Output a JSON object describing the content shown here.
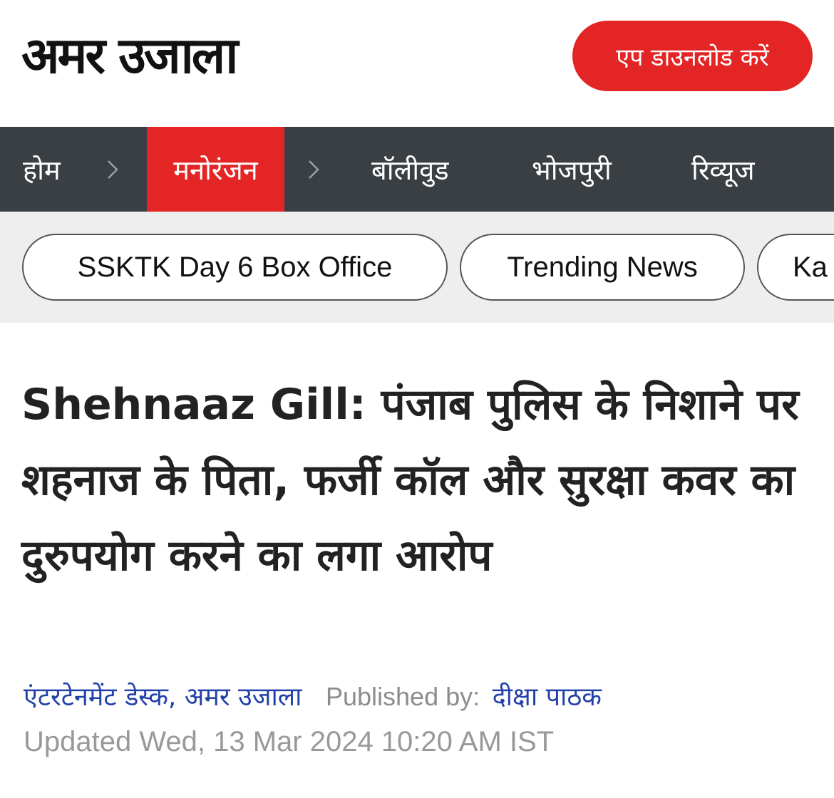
{
  "header": {
    "logo_text": "अमर उजाला",
    "app_download_label": "एप डाउनलोड करें"
  },
  "nav": {
    "items": [
      {
        "label": "होम"
      },
      {
        "label": "मनोरंजन",
        "active": true
      },
      {
        "label": "बॉलीवुड"
      },
      {
        "label": "भोजपुरी"
      },
      {
        "label": "रिव्यूज"
      }
    ],
    "separator_icon": "chevron-right-icon"
  },
  "chips": [
    {
      "label": "SSKTK Day 6 Box Office"
    },
    {
      "label": "Trending News"
    },
    {
      "label": "Ka"
    }
  ],
  "article": {
    "headline": "Shehnaaz Gill: पंजाब पुलिस के निशाने पर शहनाज के पिता, फर्जी कॉल और सुरक्षा कवर का दुरुपयोग करने का लगा आरोप",
    "desk": "एंटरटेनमेंट डेस्क, अमर उजाला",
    "published_by_label": "Published by:",
    "author": "दीक्षा पाठक",
    "updated": "Updated Wed, 13 Mar 2024 10:20 AM IST"
  },
  "colors": {
    "accent": "#e32526",
    "nav_bg": "#3a3f44",
    "link": "#2241a8",
    "chip_bar_bg": "#eeeeee"
  }
}
